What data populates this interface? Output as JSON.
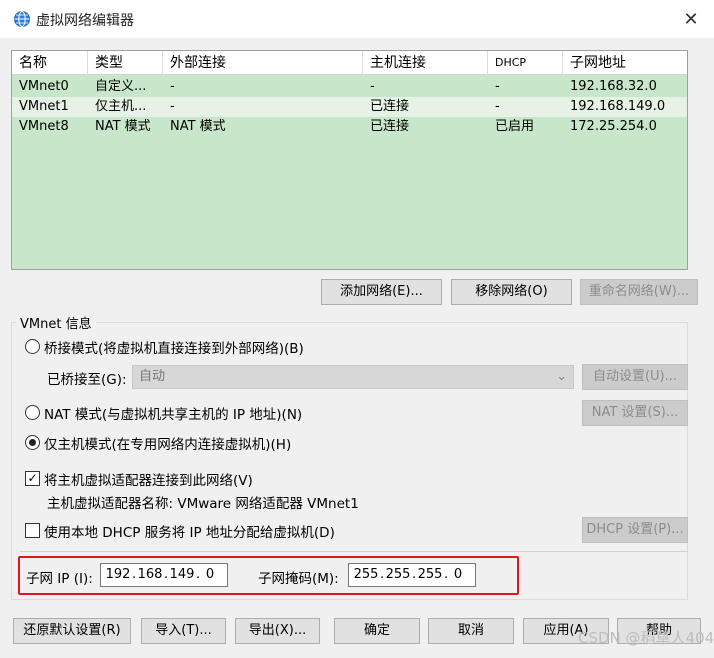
{
  "window": {
    "title": "虚拟网络编辑器",
    "close_glyph": "✕"
  },
  "table": {
    "headers": [
      "名称",
      "类型",
      "外部连接",
      "主机连接",
      "DHCP",
      "子网地址"
    ],
    "rows": [
      [
        "VMnet0",
        "自定义...",
        "-",
        "-",
        "-",
        "192.168.32.0"
      ],
      [
        "VMnet1",
        "仅主机...",
        "-",
        "已连接",
        "-",
        "192.168.149.0"
      ],
      [
        "VMnet8",
        "NAT 模式",
        "NAT 模式",
        "已连接",
        "已启用",
        "172.25.254.0"
      ]
    ]
  },
  "list_buttons": {
    "add": "添加网络(E)...",
    "remove": "移除网络(O)",
    "rename": "重命名网络(W)..."
  },
  "vmnet_info": {
    "group_title": "VMnet 信息",
    "bridged_label": "桥接模式(将虚拟机直接连接到外部网络)(B)",
    "bridged_to_label": "已桥接至(G):",
    "bridged_to_value": "自动",
    "auto_settings": "自动设置(U)...",
    "nat_label": "NAT 模式(与虚拟机共享主机的 IP 地址)(N)",
    "nat_settings": "NAT 设置(S)...",
    "hostonly_label": "仅主机模式(在专用网络内连接虚拟机)(H)",
    "connect_adapter_label": "将主机虚拟适配器连接到此网络(V)",
    "adapter_name_label": "主机虚拟适配器名称: VMware 网络适配器 VMnet1",
    "dhcp_label": "使用本地 DHCP 服务将 IP 地址分配给虚拟机(D)",
    "dhcp_settings": "DHCP 设置(P)...",
    "subnet_ip_label": "子网 IP (I):",
    "subnet_ip": [
      "192",
      "168",
      "149",
      "0"
    ],
    "subnet_mask_label": "子网掩码(M):",
    "subnet_mask": [
      "255",
      "255",
      "255",
      "0"
    ],
    "selected_mode": "hostonly",
    "connect_adapter_checked": true,
    "dhcp_checked": false
  },
  "footer": {
    "restore": "还原默认设置(R)",
    "import": "导入(T)...",
    "export": "导出(X)...",
    "ok": "确定",
    "cancel": "取消",
    "apply": "应用(A)",
    "help": "帮助"
  },
  "watermark": "CSDN @稻草人404",
  "colors": {
    "list_bg": "#c8e6c9",
    "highlight": "#e0161d"
  }
}
